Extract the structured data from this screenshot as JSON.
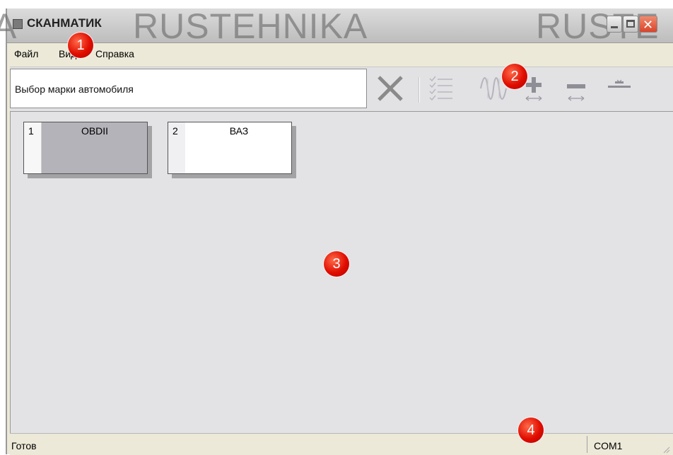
{
  "window": {
    "title": "СКАНМАТИК",
    "watermark": [
      "A",
      "RUSTEHNIKA",
      "RUSTE"
    ]
  },
  "menu": {
    "items": [
      "Файл",
      "Вид",
      "Справка"
    ]
  },
  "toolbar": {
    "vehicle_select_text": "Выбор марки автомобиля",
    "icons": [
      "close-x-icon",
      "checklist-icon",
      "waveform-icon",
      "add-gauge-icon",
      "remove-gauge-icon",
      "flat-gauge-icon"
    ]
  },
  "cards": [
    {
      "number": "1",
      "label": "OBDII"
    },
    {
      "number": "2",
      "label": "ВАЗ"
    }
  ],
  "statusbar": {
    "status": "Готов",
    "port": "COM1"
  },
  "callouts": [
    "1",
    "2",
    "3",
    "4"
  ],
  "colors": {
    "callout": "#e00d00",
    "selected_card": "#b3b3b9",
    "client_bg": "#e3e2e4"
  }
}
